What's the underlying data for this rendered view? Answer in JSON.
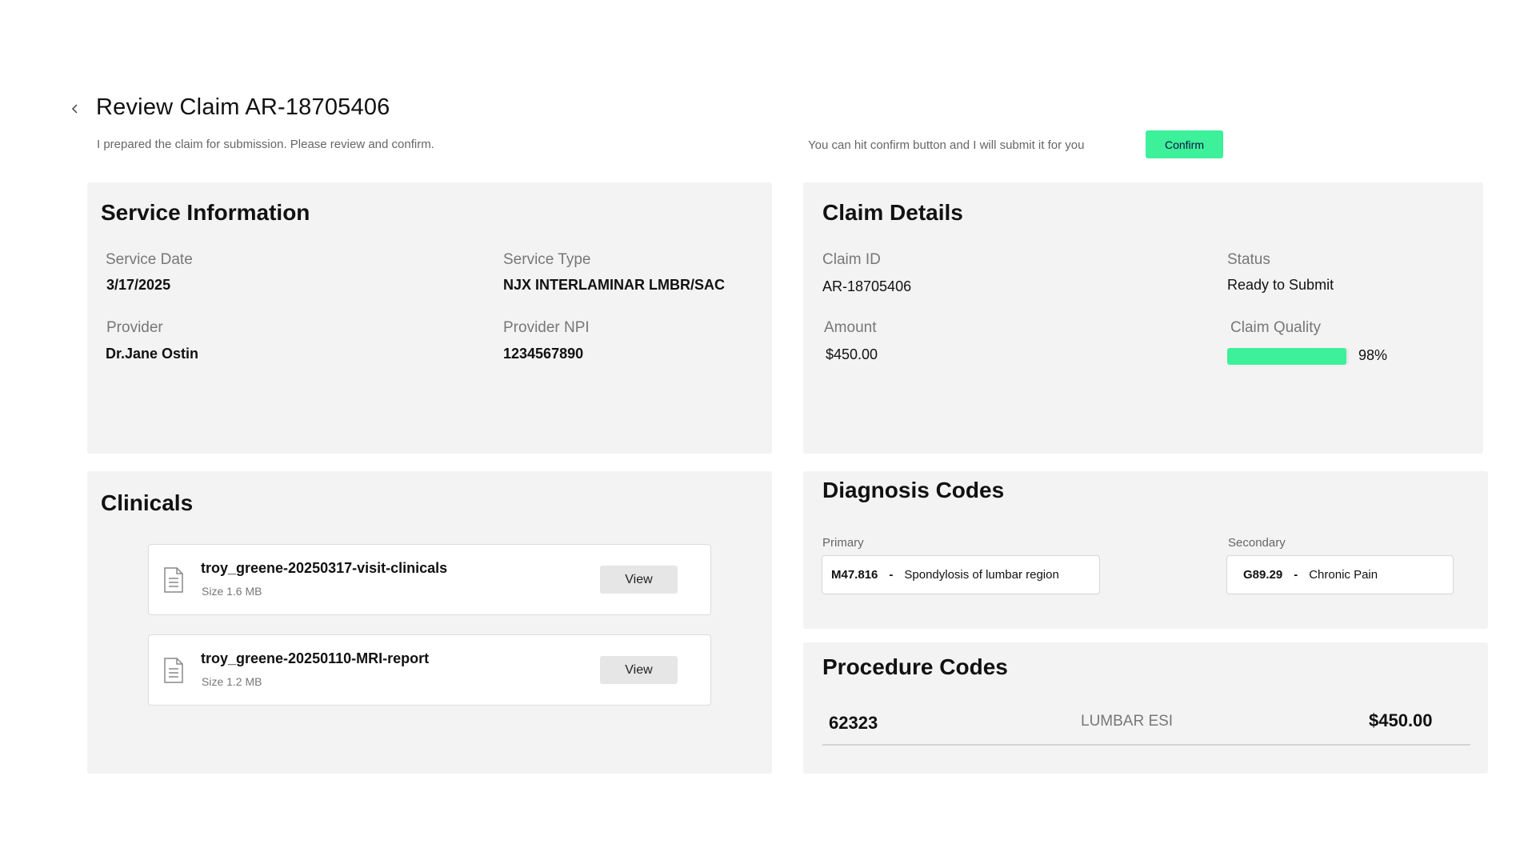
{
  "header": {
    "title": "Review Claim AR-18705406",
    "subtitle": "I prepared the claim for submission. Please review and confirm.",
    "hint": "You can hit confirm button and I will submit it for you",
    "confirm_label": "Confirm"
  },
  "service": {
    "title": "Service Information",
    "service_date_label": "Service Date",
    "service_date": "3/17/2025",
    "service_type_label": "Service Type",
    "service_type": "NJX INTERLAMINAR LMBR/SAC",
    "provider_label": "Provider",
    "provider": "Dr.Jane Ostin",
    "provider_npi_label": "Provider NPI",
    "provider_npi": "1234567890"
  },
  "claim": {
    "title": "Claim Details",
    "claim_id_label": "Claim ID",
    "claim_id": "AR-18705406",
    "status_label": "Status",
    "status": "Ready to Submit",
    "amount_label": "Amount",
    "amount": "$450.00",
    "quality_label": "Claim Quality",
    "quality_percent": 98,
    "quality_text": "98%",
    "quality_color": "#3df09a"
  },
  "clinicals": {
    "title": "Clinicals",
    "files": [
      {
        "name": "troy_greene-20250317-visit-clinicals",
        "size": "Size 1.6 MB",
        "view_label": "View",
        "icon": "document-icon"
      },
      {
        "name": "troy_greene-20250110-MRI-report",
        "size": "Size 1.2 MB",
        "view_label": "View",
        "icon": "document-icon"
      }
    ]
  },
  "diagnosis": {
    "title": "Diagnosis Codes",
    "primary_label": "Primary",
    "primary_code": "M47.816",
    "primary_sep": "-",
    "primary_desc": "Spondylosis of lumbar region",
    "secondary_label": "Secondary",
    "secondary_code": "G89.29",
    "secondary_sep": "-",
    "secondary_desc": "Chronic Pain"
  },
  "procedure": {
    "title": "Procedure Codes",
    "rows": [
      {
        "code": "62323",
        "desc": "LUMBAR ESI",
        "amount": "$450.00"
      }
    ]
  },
  "colors": {
    "accent": "#3df09a",
    "card_bg": "#f3f3f3"
  }
}
